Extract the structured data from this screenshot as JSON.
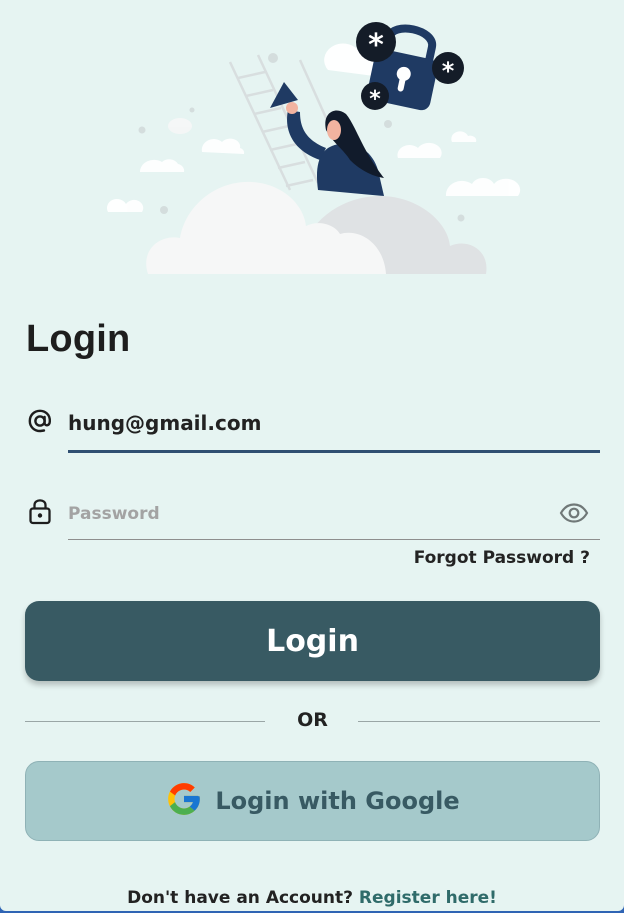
{
  "page": {
    "title": "Login"
  },
  "form": {
    "email": {
      "value": "hung@gmail.com",
      "icon": "at-sign-icon"
    },
    "password": {
      "value": "",
      "placeholder": "Password",
      "icon": "lock-icon",
      "toggle_icon": "eye-icon"
    },
    "forgot_password": "Forgot Password ?",
    "login_button": "Login",
    "divider_text": "OR",
    "google_button": "Login with Google",
    "google_icon": "google-g-icon"
  },
  "footer": {
    "prompt": "Don't have an Account? ",
    "register_link": "Register here!"
  },
  "colors": {
    "background": "#e6f4f2",
    "primary_button": "#385a63",
    "google_button": "#a5c9cb",
    "accent_link": "#2f6b6a",
    "input_underline": "#2f4f72",
    "illustration_navy": "#1f3a63"
  }
}
